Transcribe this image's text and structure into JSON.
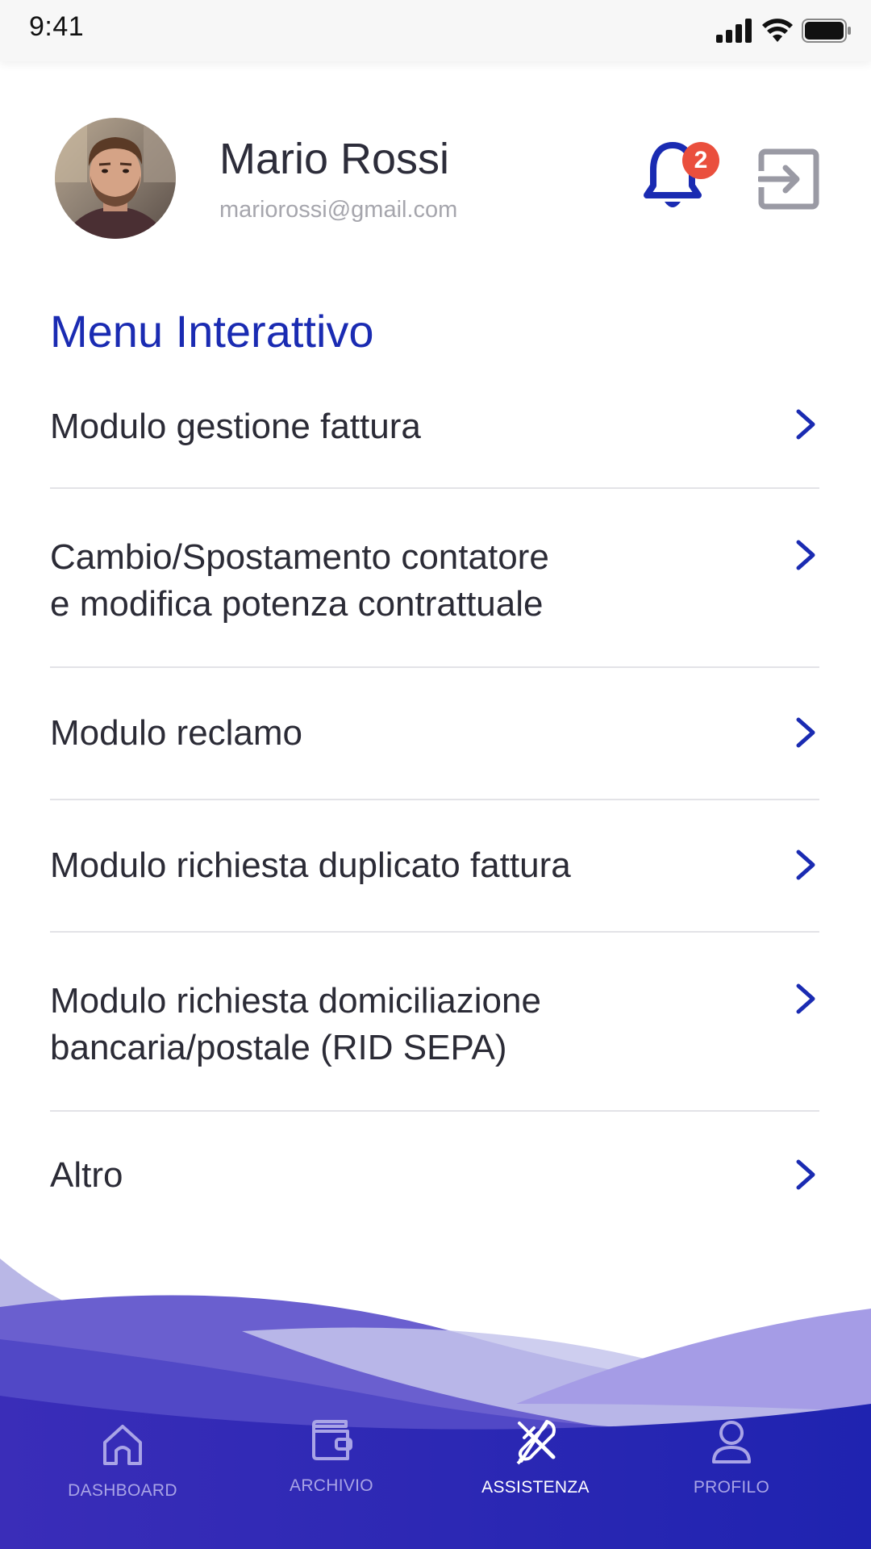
{
  "status_bar": {
    "time": "9:41"
  },
  "profile": {
    "name": "Mario Rossi",
    "email": "mariorossi@gmail.com",
    "notification_count": "2"
  },
  "section_title": "Menu Interattivo",
  "menu": [
    {
      "label": "Modulo gestione fattura"
    },
    {
      "label": "Cambio/Spostamento contatore\ne modifica potenza contrattuale"
    },
    {
      "label": "Modulo reclamo"
    },
    {
      "label": "Modulo richiesta duplicato fattura"
    },
    {
      "label": "Modulo richiesta domiciliazione\nbancaria/postale (RID SEPA)"
    },
    {
      "label": "Altro"
    }
  ],
  "bottom_nav": [
    {
      "label": "DASHBOARD",
      "icon": "home-icon",
      "active": false
    },
    {
      "label": "ARCHIVIO",
      "icon": "wallet-icon",
      "active": false
    },
    {
      "label": "ASSISTENZA",
      "icon": "tools-icon",
      "active": true
    },
    {
      "label": "PROFILO",
      "icon": "user-icon",
      "active": false
    }
  ],
  "colors": {
    "accent": "#1a2bb2",
    "badge": "#ea4f3d",
    "nav_background": "#2b22b5",
    "nav_label_inactive": "#a9a4e6",
    "nav_label_active": "#ffffff"
  }
}
